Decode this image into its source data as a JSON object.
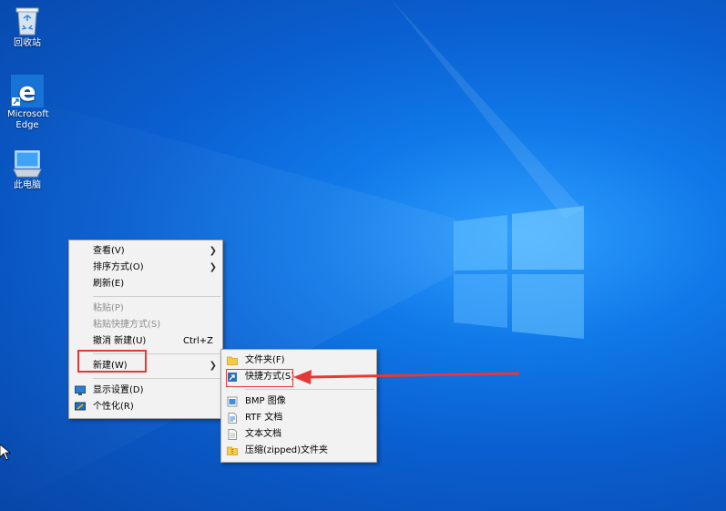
{
  "desktop": {
    "icons": [
      {
        "label": "回收站",
        "icon": "recycle-bin-icon"
      },
      {
        "label": "Microsoft Edge",
        "icon": "edge-icon"
      },
      {
        "label": "此电脑",
        "icon": "this-pc-icon"
      }
    ]
  },
  "context_menu": {
    "items": [
      {
        "label": "查看(V)",
        "has_submenu": true
      },
      {
        "label": "排序方式(O)",
        "has_submenu": true
      },
      {
        "label": "刷新(E)"
      },
      {
        "label": "粘贴(P)",
        "disabled": true
      },
      {
        "label": "粘贴快捷方式(S)",
        "disabled": true
      },
      {
        "label": "撤消 新建(U)",
        "shortcut": "Ctrl+Z"
      },
      {
        "label": "新建(W)",
        "has_submenu": true,
        "highlighted": true
      },
      {
        "label": "显示设置(D)",
        "icon": "display-settings-icon"
      },
      {
        "label": "个性化(R)",
        "icon": "personalize-icon"
      }
    ]
  },
  "new_submenu": {
    "items": [
      {
        "label": "文件夹(F)",
        "icon": "folder-icon"
      },
      {
        "label": "快捷方式(S)",
        "icon": "shortcut-icon",
        "annotated": true
      },
      {
        "label": "BMP 图像",
        "icon": "bmp-icon"
      },
      {
        "label": "RTF 文档",
        "icon": "rtf-icon"
      },
      {
        "label": "文本文档",
        "icon": "text-doc-icon"
      },
      {
        "label": "压缩(zipped)文件夹",
        "icon": "zip-folder-icon"
      }
    ]
  },
  "colors": {
    "annotation": "#e53935",
    "desktop_blue": "#0a5fd0"
  }
}
